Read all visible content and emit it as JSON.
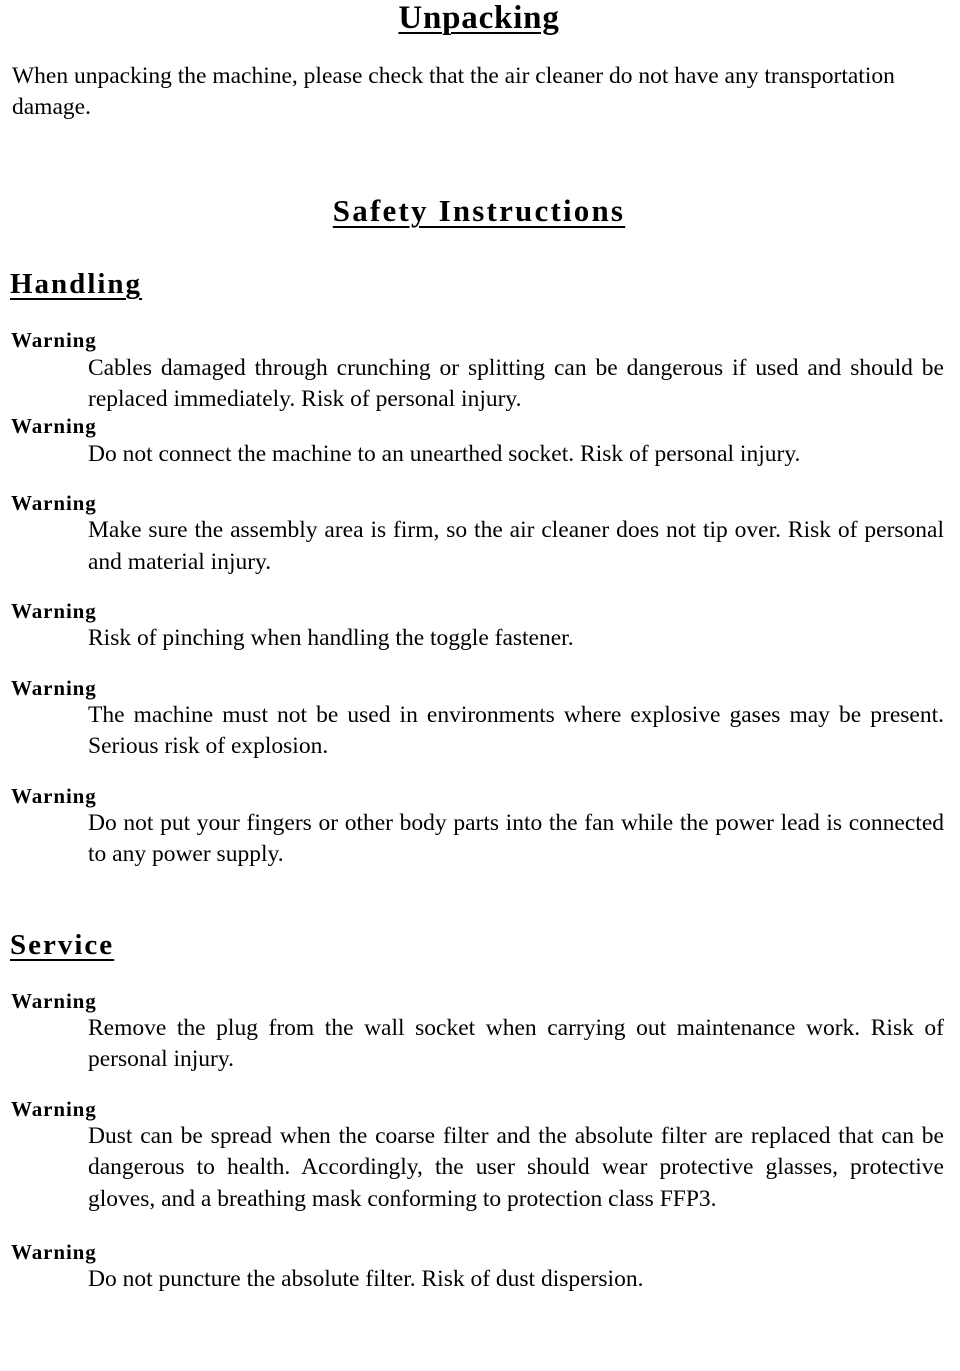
{
  "document": {
    "unpacking": {
      "heading": "Unpacking",
      "body": "When unpacking the machine, please check that the air cleaner do not have any transportation damage."
    },
    "safety": {
      "heading": "Safety Instructions"
    },
    "handling": {
      "heading": "Handling",
      "warnings": [
        {
          "label": "Warning",
          "text": "Cables damaged through crunching or splitting can be dangerous if used and should be replaced immediately.  Risk of personal injury."
        },
        {
          "label": "Warning",
          "text": "Do not connect the machine to an unearthed socket. Risk of personal injury."
        },
        {
          "label": "Warning",
          "text": "Make sure the assembly area is firm, so the air cleaner does not tip over. Risk of personal and material injury."
        },
        {
          "label": "Warning",
          "text": "Risk of pinching when handling the toggle fastener."
        },
        {
          "label": "Warning",
          "text": "The machine must not be used in environments where explosive gases may be present. Serious risk of explosion."
        },
        {
          "label": "Warning",
          "text": "Do not put your fingers or other body parts into the fan while the power lead is connected to any power supply."
        }
      ]
    },
    "service": {
      "heading": "Service",
      "warnings": [
        {
          "label": "Warning",
          "text": "Remove the plug from the wall socket when carrying out maintenance work. Risk of personal injury."
        },
        {
          "label": "Warning",
          "text": "Dust can be spread when the coarse filter and the absolute filter are replaced that can be dangerous to health. Accordingly, the user should wear protective glasses, protective gloves, and a breathing mask conforming to protection class FFP3."
        },
        {
          "label": "Warning",
          "text": "Do not puncture the absolute filter. Risk of dust dispersion."
        }
      ]
    }
  }
}
